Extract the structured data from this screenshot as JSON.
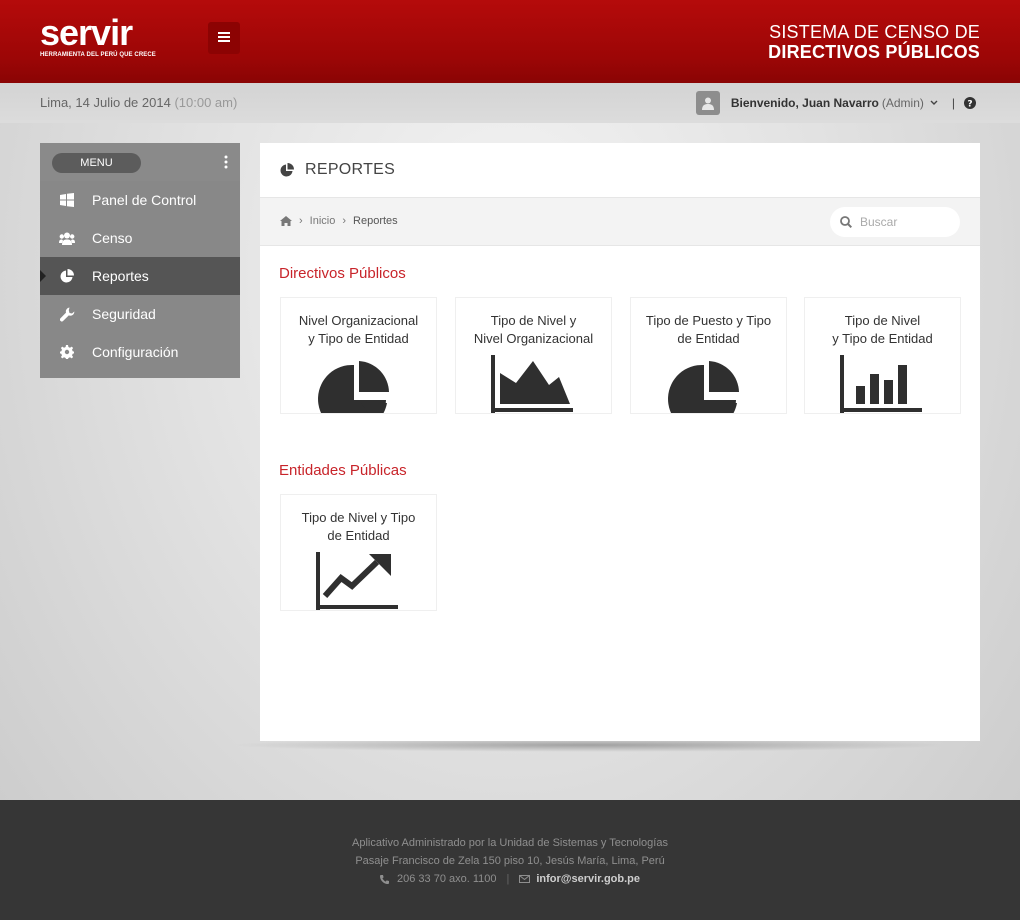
{
  "header": {
    "logo_text": "servir",
    "logo_tagline": "HERRAMIENTA DEL PERÚ QUE CRECE",
    "title_line1": "SISTEMA DE CENSO  DE",
    "title_line2": "DIRECTIVOS PÚBLICOS",
    "menu_toggle_icon": "hamburger-icon"
  },
  "infobar": {
    "date": "Lima, 14 Julio de 2014 ",
    "time": "(10:00 am)",
    "welcome": "Bienvenido, Juan Navarro",
    "role": "(Admin)",
    "separator": "|"
  },
  "sidebar": {
    "menu_label": "MENU",
    "items": [
      {
        "label": "Panel de Control",
        "icon": "windows-icon"
      },
      {
        "label": "Censo",
        "icon": "users-icon"
      },
      {
        "label": "Reportes",
        "icon": "pie-chart-icon",
        "active": true
      },
      {
        "label": "Seguridad",
        "icon": "wrench-icon"
      },
      {
        "label": "Configuración",
        "icon": "gear-icon"
      }
    ]
  },
  "main": {
    "title": "REPORTES",
    "breadcrumb": [
      "Inicio",
      "Reportes"
    ],
    "search_placeholder": "Buscar",
    "sections": [
      {
        "title": "Directivos Públicos",
        "cards": [
          {
            "label_lines": [
              "Nivel Organizacional",
              "y Tipo de Entidad"
            ],
            "icon": "pie-chart-icon"
          },
          {
            "label_lines": [
              "Tipo de Nivel y",
              "Nivel Organizacional"
            ],
            "icon": "area-chart-icon"
          },
          {
            "label_lines": [
              "Tipo de Puesto y Tipo",
              "de Entidad"
            ],
            "icon": "pie-chart-icon"
          },
          {
            "label_lines": [
              "Tipo de Nivel",
              "y Tipo de Entidad"
            ],
            "icon": "bar-chart-icon"
          }
        ]
      },
      {
        "title": "Entidades Públicas",
        "cards": [
          {
            "label_lines": [
              "Tipo de Nivel y Tipo",
              "de Entidad"
            ],
            "icon": "line-chart-icon"
          }
        ]
      }
    ]
  },
  "footer": {
    "line1": "Aplicativo Administrado por la Unidad de Sistemas y Tecnologías",
    "line2": "Pasaje Francisco de Zela 150 piso 10, Jesús María, Lima, Perú",
    "phone": "206 33 70 axo. 1100",
    "email": "infor@servir.gob.pe"
  },
  "colors": {
    "brand_red": "#a50808",
    "accent_red": "#c8242a",
    "sidebar": "#888888",
    "sidebar_active": "#555555",
    "footer": "#363636"
  }
}
